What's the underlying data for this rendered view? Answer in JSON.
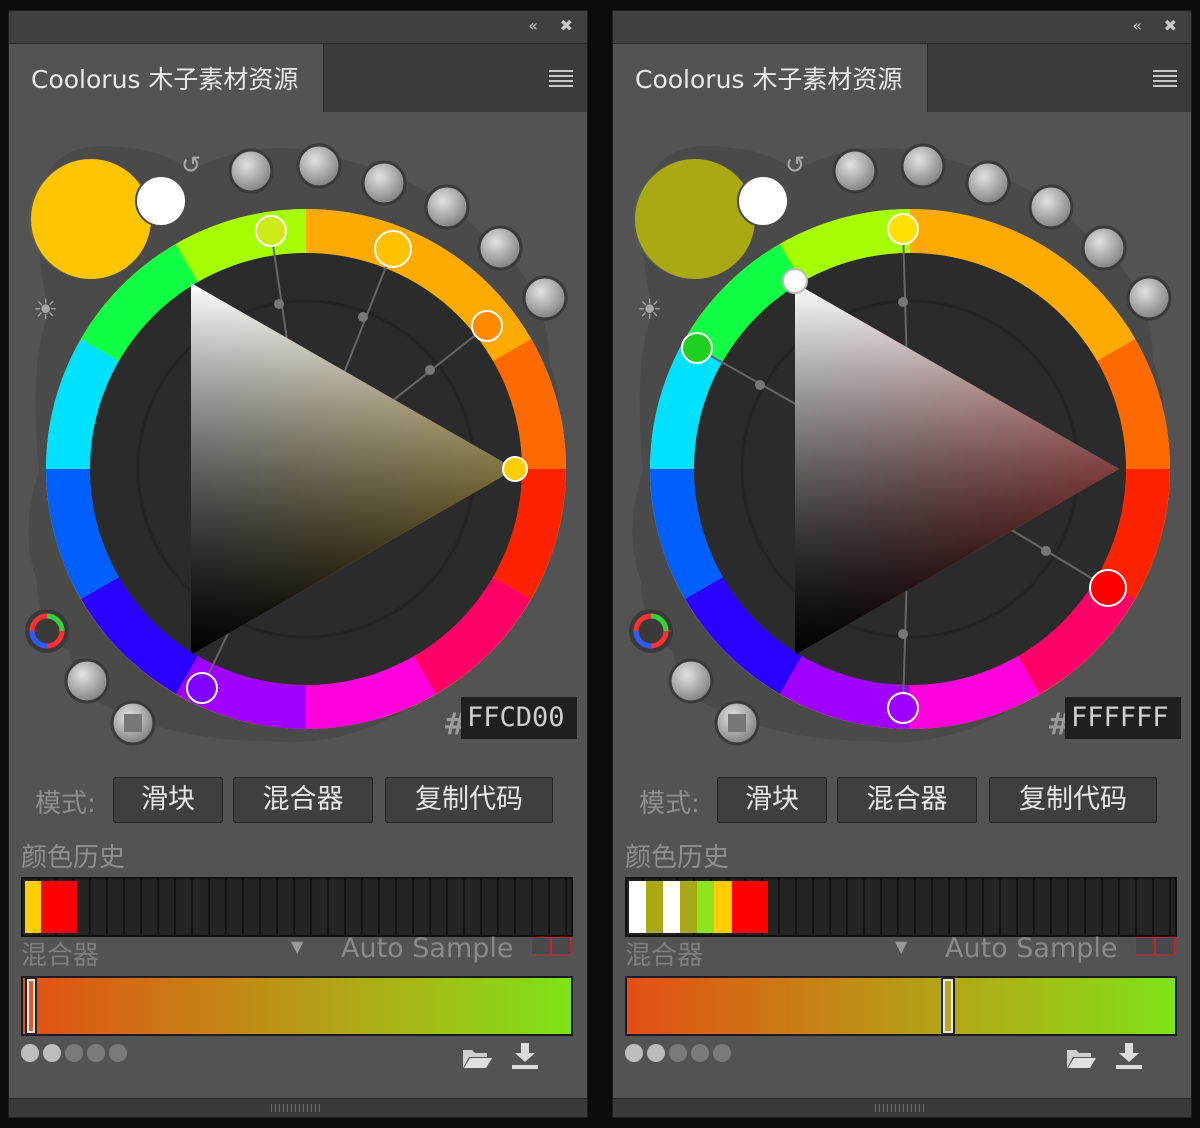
{
  "panels": [
    {
      "title": "Coolorus 木子素材资源",
      "hex_prefix": "#",
      "hex_value": "FFCD00",
      "mode_label": "模式:",
      "buttons": [
        "滑块",
        "混合器",
        "复制代码"
      ],
      "history_label": "颜色历史",
      "history_swatches": [
        "#ffcd00",
        "#ff0000",
        "#ff0000"
      ],
      "mixer_label": "混合器",
      "auto_sample_label": "Auto Sample",
      "mixer_position": 0.01,
      "active_dots": 2,
      "colors": {
        "foreground": "#ffc600",
        "background": "#ffffff",
        "triangle_hue": "#ffcd00"
      }
    },
    {
      "title": "Coolorus 木子素材资源",
      "hex_prefix": "#",
      "hex_value": "FFFFFF",
      "mode_label": "模式:",
      "buttons": [
        "滑块",
        "混合器",
        "复制代码"
      ],
      "history_label": "颜色历史",
      "history_swatches": [
        "#ffffff",
        "#a9a914",
        "#ffffff",
        "#a9a914",
        "#8ee41d",
        "#ffcd00",
        "#ff0000",
        "#ff0000"
      ],
      "mixer_label": "混合器",
      "auto_sample_label": "Auto Sample",
      "mixer_position": 0.58,
      "active_dots": 2,
      "colors": {
        "foreground": "#a9a914",
        "background": "#ffffff",
        "triangle_hue": "#ff0000"
      }
    }
  ]
}
